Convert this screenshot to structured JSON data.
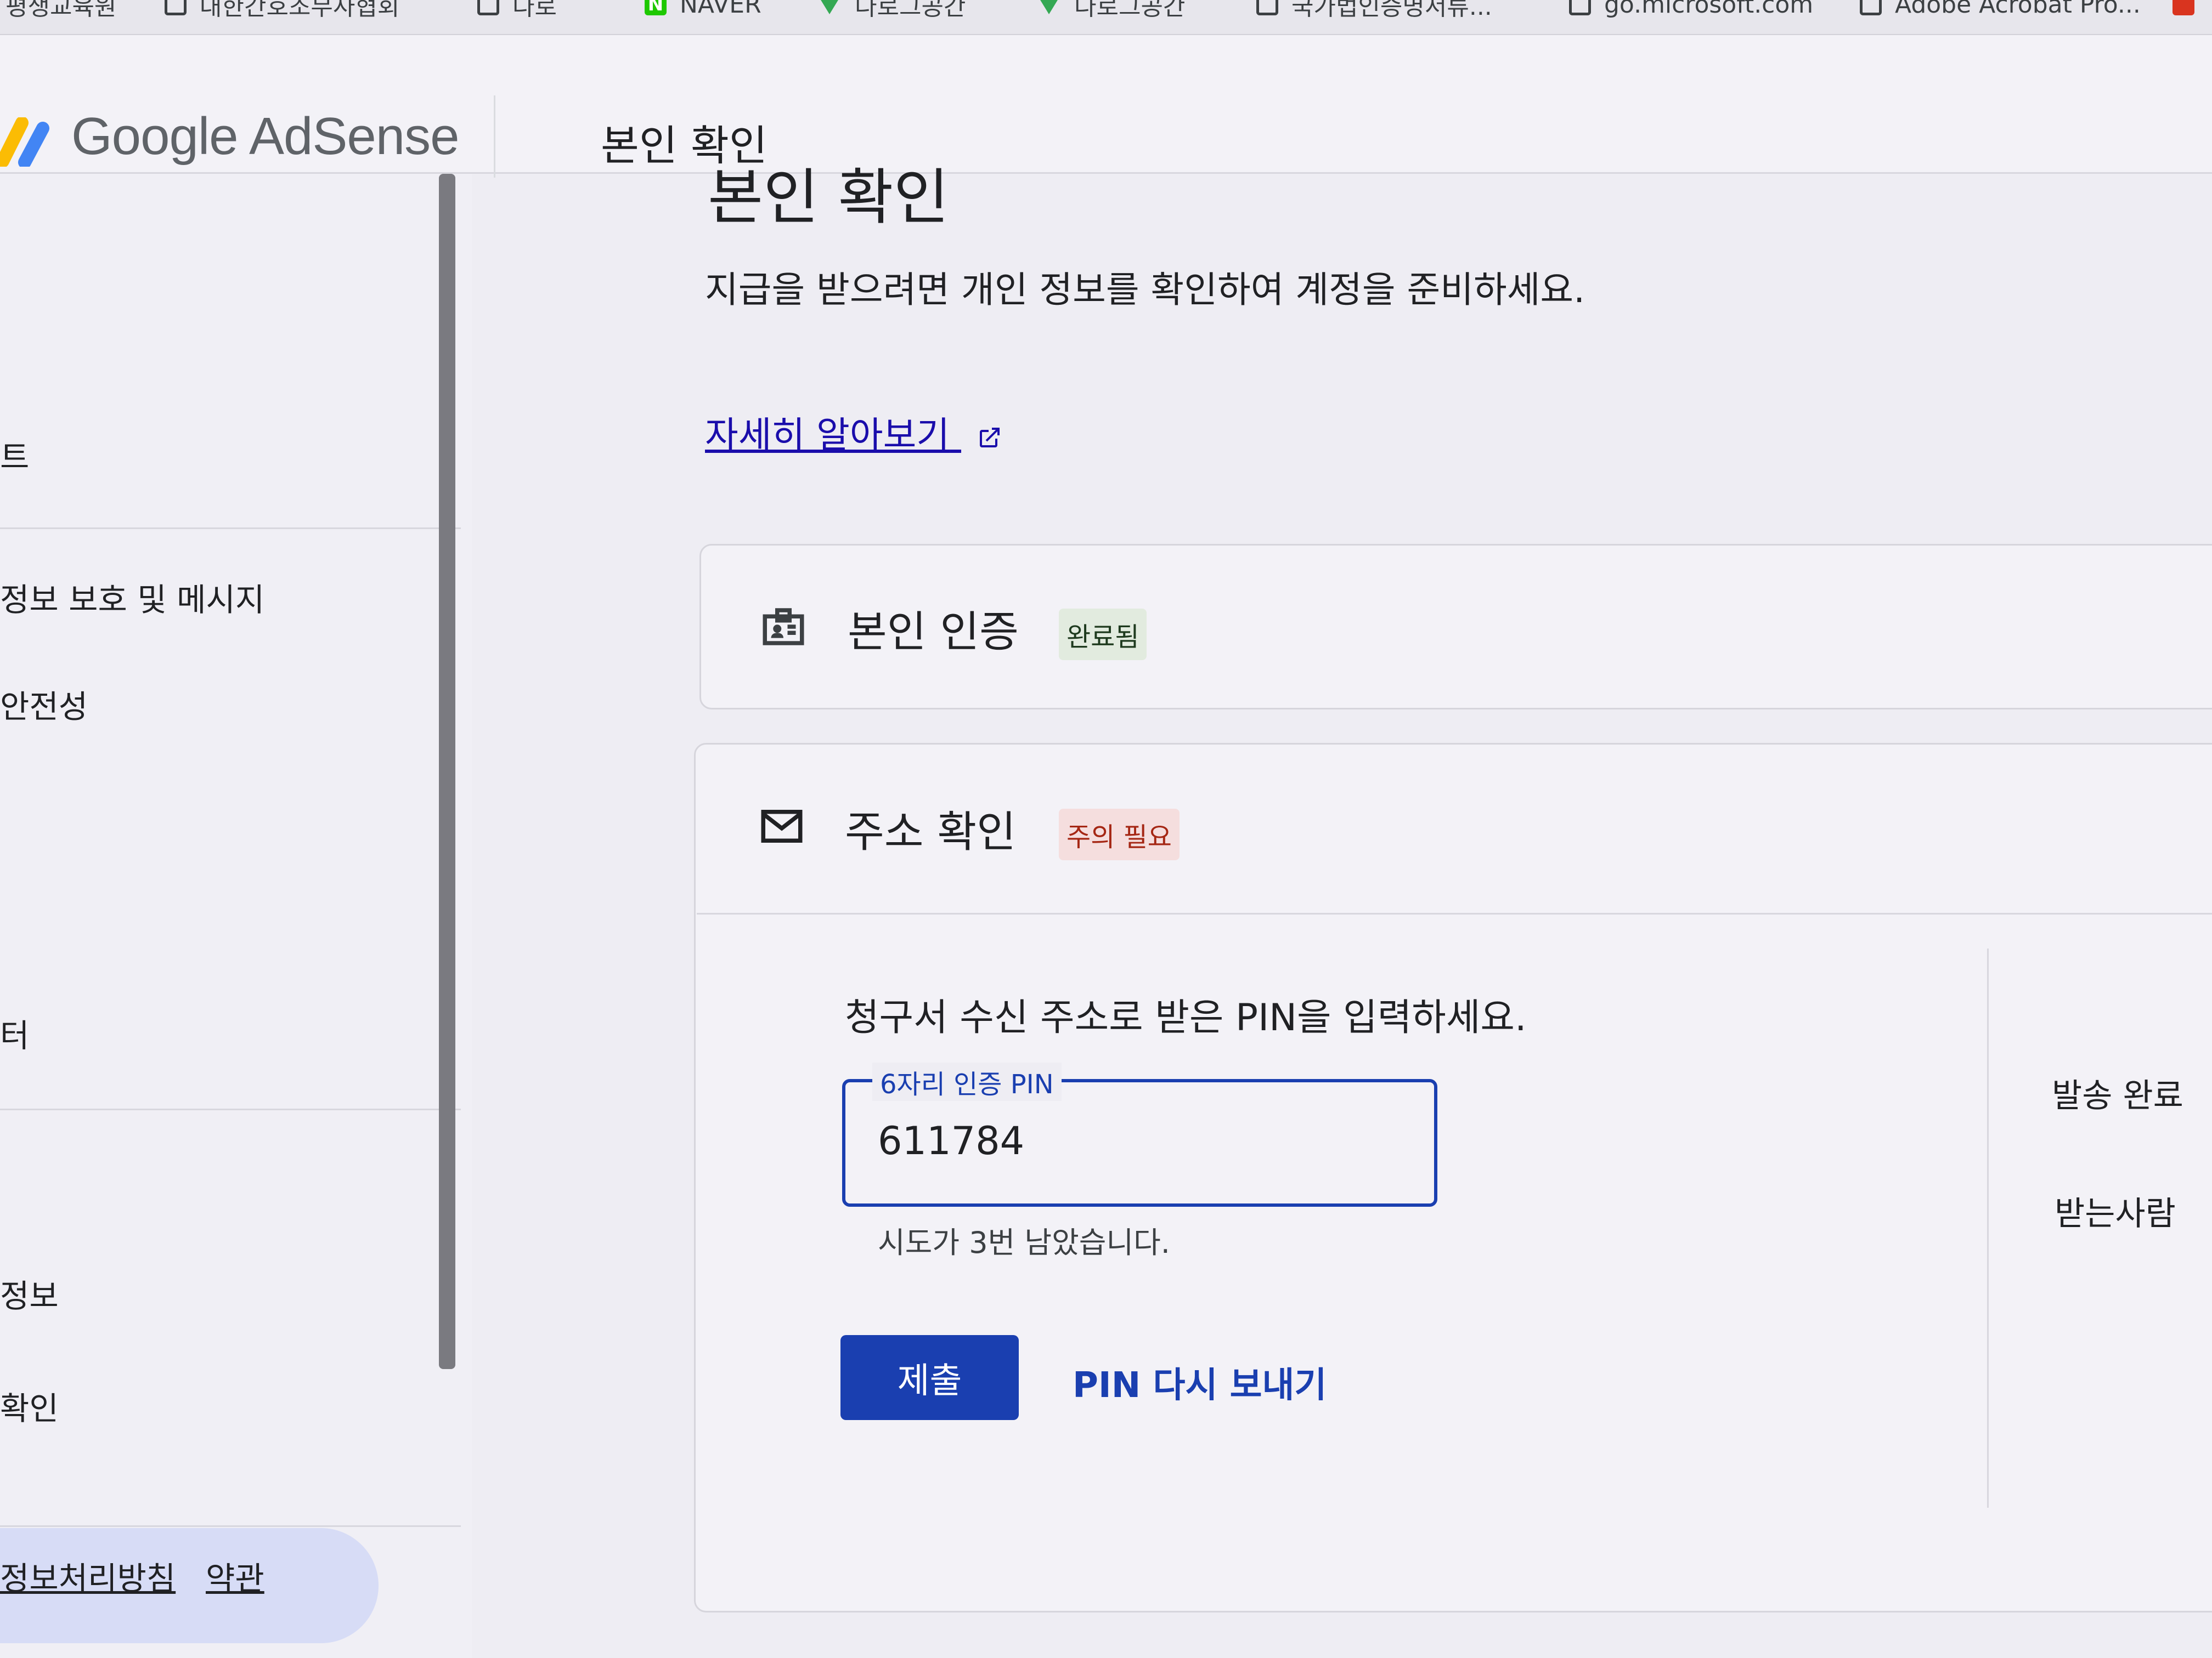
{
  "bookmarks": [
    {
      "label": "평생교육원",
      "icon": "none"
    },
    {
      "label": "대한간호조무사협회",
      "icon": "page-icon"
    },
    {
      "label": "다로",
      "icon": "page-icon"
    },
    {
      "label": "NAVER",
      "icon": "naver-icon"
    },
    {
      "label": "다로그공간",
      "icon": "triangle-icon"
    },
    {
      "label": "다로그공간",
      "icon": "triangle-icon"
    },
    {
      "label": "국가법인증명서류...",
      "icon": "page-icon"
    },
    {
      "label": "go.microsoft.com",
      "icon": "page-icon"
    },
    {
      "label": "Adobe Acrobat Pro...",
      "icon": "page-icon"
    }
  ],
  "header": {
    "brand": "Google AdSense",
    "title": "본인 확인"
  },
  "sidebar": {
    "items": [
      "트",
      "정보 보호 및 메시지",
      "안전성",
      "터",
      "정보",
      "확인"
    ],
    "footer_links": [
      "정보처리방침",
      "약관"
    ]
  },
  "main": {
    "page_title": "본인 확인",
    "description": "지급을 받으려면 개인 정보를 확인하여 계정을 준비하세요.",
    "learn_more": "자세히 알아보기",
    "identity_card": {
      "title": "본인 인증",
      "status": "완료됨"
    },
    "address_card": {
      "title": "주소 확인",
      "status": "주의 필요",
      "prompt": "청구서 수신 주소로 받은 PIN을 입력하세요.",
      "pin_label": "6자리 인증 PIN",
      "pin_value": "611784",
      "attempts_text": "시도가 3번 남았습니다.",
      "submit_label": "제출",
      "resend_label": "PIN 다시 보내기",
      "side_labels": [
        "발송 완료",
        "받는사람"
      ]
    }
  },
  "colors": {
    "accent": "#1a3fb0",
    "link": "#1a0dab",
    "success_badge": "#e2ebdf",
    "warning_badge": "#f5dede",
    "active_nav": "#d7dcf6"
  }
}
